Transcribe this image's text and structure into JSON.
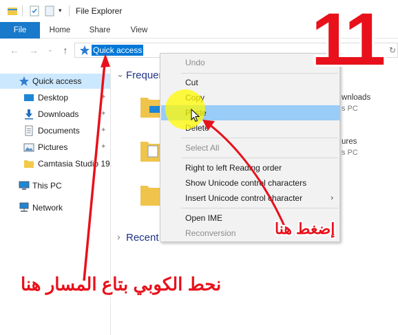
{
  "window": {
    "title": "File Explorer"
  },
  "ribbon": {
    "tabs": [
      "File",
      "Home",
      "Share",
      "View"
    ]
  },
  "address": {
    "path": "Quick access"
  },
  "navpane": {
    "items": [
      {
        "label": "Quick access",
        "icon": "star-icon"
      },
      {
        "label": "Desktop",
        "icon": "desktop-icon"
      },
      {
        "label": "Downloads",
        "icon": "download-icon"
      },
      {
        "label": "Documents",
        "icon": "documents-icon"
      },
      {
        "label": "Pictures",
        "icon": "pictures-icon"
      },
      {
        "label": "Camtasia Studio 19",
        "icon": "folder-icon"
      },
      {
        "label": "This PC",
        "icon": "computer-icon"
      },
      {
        "label": "Network",
        "icon": "network-icon"
      }
    ]
  },
  "content": {
    "frequent_header": "Frequer",
    "recent_header": "Recent",
    "side_items": [
      {
        "title": "wnloads",
        "sub": "s PC"
      },
      {
        "title": "ures",
        "sub": "s PC"
      }
    ]
  },
  "context_menu": {
    "items": [
      "Undo",
      "Cut",
      "Copy",
      "Paste",
      "Delete",
      "Select All",
      "Right to left Reading order",
      "Show Unicode control characters",
      "Insert Unicode control character",
      "Open IME",
      "Reconversion"
    ],
    "submenu_arrow": "›"
  },
  "annotations": {
    "step_number": "11",
    "click_here": "إضغط هنا",
    "paste_path_here": "نحط الكوبي بتاع المسار هنا"
  },
  "colors": {
    "accent": "#1979ca",
    "selection": "#0078d7",
    "annotation": "#e8111b",
    "highlight": "#fffa00"
  }
}
